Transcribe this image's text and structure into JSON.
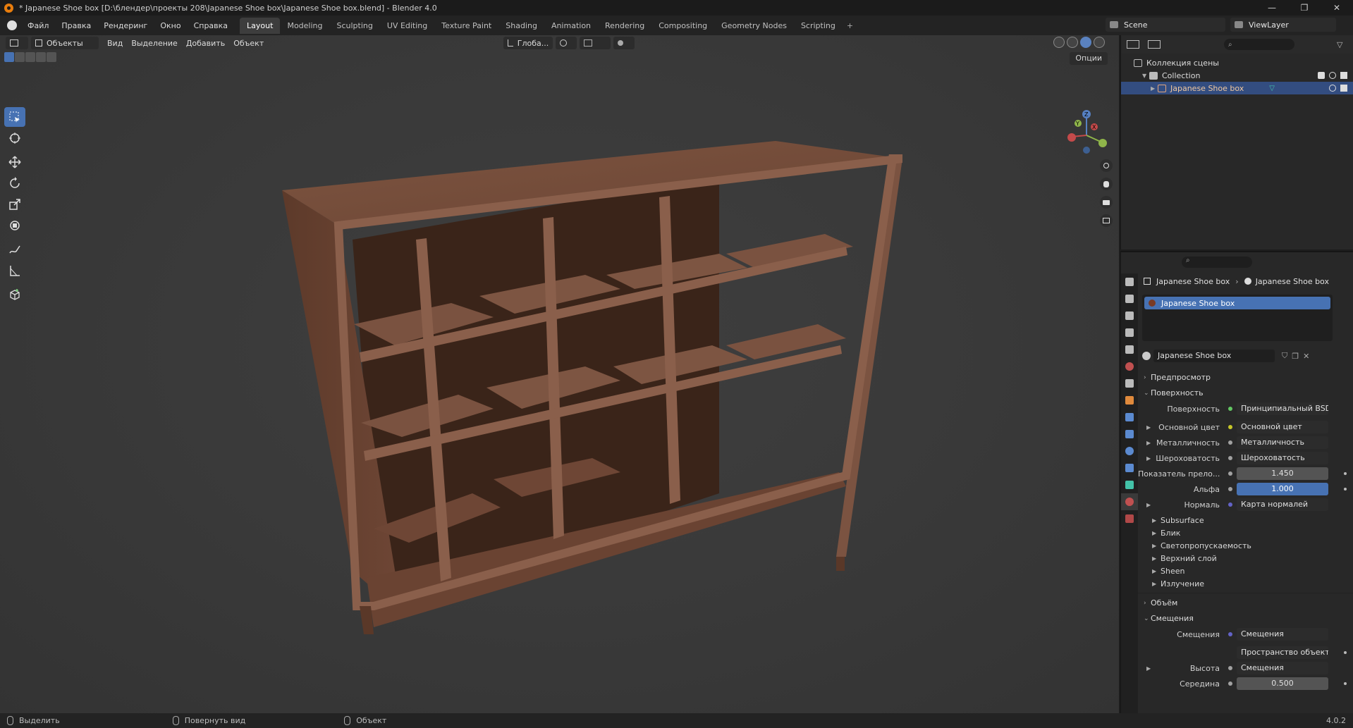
{
  "titlebar": {
    "title": "* Japanese Shoe box [D:\\блендер\\проекты 208\\Japanese Shoe box\\Japanese Shoe box.blend] - Blender 4.0",
    "minimize": "—",
    "maximize": "❐",
    "close": "✕"
  },
  "menu": [
    "Файл",
    "Правка",
    "Рендеринг",
    "Окно",
    "Справка"
  ],
  "workspaces": [
    "Layout",
    "Modeling",
    "Sculpting",
    "UV Editing",
    "Texture Paint",
    "Shading",
    "Animation",
    "Rendering",
    "Compositing",
    "Geometry Nodes",
    "Scripting"
  ],
  "active_workspace": "Layout",
  "workspace_add": "+",
  "scene": "Scene",
  "view_layer": "ViewLayer",
  "viewport": {
    "mode": "Объекты",
    "menus": [
      "Вид",
      "Выделение",
      "Добавить",
      "Объект"
    ],
    "orientation": "Глоба...",
    "options": "Опции",
    "gizmo_axes": {
      "x": "X",
      "y": "Y",
      "z": "Z"
    }
  },
  "outliner": {
    "scene_collection": "Коллекция сцены",
    "collection": "Collection",
    "object": "Japanese Shoe box"
  },
  "properties": {
    "breadcrumb_object": "Japanese Shoe box",
    "breadcrumb_material": "Japanese Shoe box",
    "material_slot": "Japanese Shoe box",
    "material_name": "Japanese Shoe box",
    "sections": {
      "preview": "Предпросмотр",
      "surface": "Поверхность",
      "volume": "Объём",
      "displacement": "Смещения"
    },
    "surface_rows": [
      {
        "label": "Поверхность",
        "value": "Принципиальный BSDF",
        "socket": "#63c763",
        "expandable": false
      },
      {
        "label": "Основной цвет",
        "value": "Основной цвет",
        "socket": "#c7c729",
        "expandable": true
      },
      {
        "label": "Металличность",
        "value": "Металличность",
        "socket": "#a1a1a1",
        "expandable": true
      },
      {
        "label": "Шероховатость",
        "value": "Шероховатость",
        "socket": "#a1a1a1",
        "expandable": true
      }
    ],
    "ior": {
      "label": "Показатель прело...",
      "value": "1.450"
    },
    "alpha": {
      "label": "Альфа",
      "value": "1.000"
    },
    "normal": {
      "label": "Нормаль",
      "value": "Карта нормалей"
    },
    "subpanels": [
      "Subsurface",
      "Блик",
      "Светопропускаемость",
      "Верхний слой",
      "Sheen",
      "Излучение"
    ],
    "displacement_rows": {
      "label": "Смещения",
      "value": "Смещения",
      "space": "Пространство объекта",
      "height_label": "Высота",
      "height_value": "Смещения",
      "midlevel_label": "Середина",
      "midlevel_value": "0.500"
    }
  },
  "statusbar": {
    "select": "Выделить",
    "rotate": "Повернуть вид",
    "object": "Объект",
    "version": "4.0.2"
  }
}
